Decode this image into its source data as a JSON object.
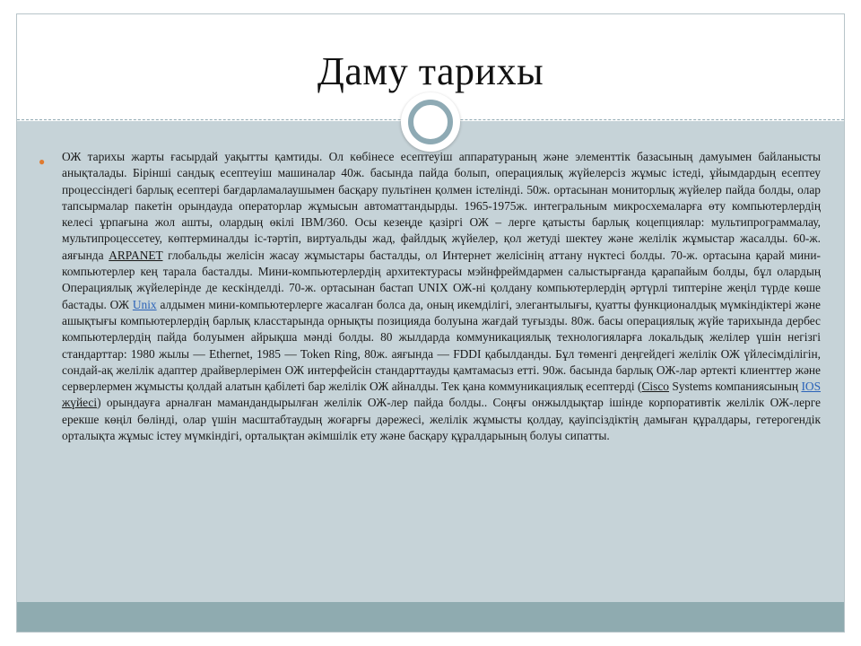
{
  "slide": {
    "title": "Даму тарихы",
    "paragraph": [
      "ОЖ тарихы жарты ғасырдай уақытты қамтиды. Ол көбінесе есептеуіш аппаратураның және элементтік базасының дамуымен байланысты анықталады. Бірінші сандық есептеуіш машиналар 40ж. басында пайда болып, операциялық жүйелерсіз жұмыс істеді, ұйымдардың есептеу процессіндегі барлық есептері бағдарламалаушымен басқару пультінен қолмен істелінді. 50ж. ортасынан мониторлық жүйелер пайда болды, олар тапсырмалар пакетін орындауда операторлар жұмысын автоматтандырды. 1965-1975ж. интегральным микросхемаларға өту компьютерлердің келесі ұрпағына жол ашты, олардың өкілі IBM/360. Осы кезеңде қазіргі ОЖ – лерге қатысты барлық коцепциялар: мультипрограммалау, мультипроцессетеу, көптерминалды іс-тәртіп, виртуальды жад, файлдық жүйелер, қол жетуді шектеу және желілік жұмыстар жасалды. 60-ж. аяғында ",
      " глобальды желісін жасау жұмыстары басталды, ол Интернет желісінің аттану нүктесі болды. 70-ж. ортасына қарай мини-компьютерлер кең тарала басталды. Мини-компьютерлердің архитектурасы мэйнфреймдармен салыстырғанда қарапайым болды, бұл олардың Операциялық жүйелерінде де кескінделді. 70-ж. ортасынан бастап UNIX ОЖ-ні қолдану компьютерлердің әртүрлі типтеріне жеңіл түрде көше бастады. ОЖ ",
      " алдымен мини-компьютерлерге жасалған болса да, оның икемділігі, элегантылығы, қуатты функционалдық мүмкіндіктері және ашықтығы компьютерлердің барлық класстарында орнықты позицияда болуына жағдай туғызды. 80ж. басы операциялық жүйе тарихында дербес компьютерлердің пайда болуымен айрықша мәнді болды. 80 жылдарда коммуникациялық технологияларға локальдық желілер үшін негізгі стандарттар: 1980 жылы — Ethernet, 1985 — Token Ring, 80ж. аяғында — FDDI қабылданды. Бұл төменгі деңгейдегі желілік ОЖ үйлесімділігін, сондай-ақ желілік адаптер драйверлерімен ОЖ интерфейсін стандарттауды қамтамасыз етті. 90ж. басында барлық ОЖ-лар әртекті клиенттер және серверлермен жұмысты қолдай алатын қабілеті бар желілік ОЖ айналды. Тек қана коммуникациялық есептерді (",
      " Systems компаниясының ",
      ") орындауға арналған мамандандырылған желілік ОЖ-лер пайда болды.. Соңғы онжылдықтар ішінде корпоративтік желілік ОЖ-лерге ерекше көңіл бөлінді, олар үшін масштабтаудың жоғарғы дәрежесі, желілік жұмысты қолдау, қауіпсіздіктің дамыған құралдары, гетерогендік орталықта жұмыс істеу мүмкіндігі, орталықтан әкімшілік ету және басқару құралдарының болуы сипатты."
    ],
    "links": {
      "arpanet": "ARPANET",
      "unix": "Unix",
      "cisco": "Cisco",
      "ios": "IOS",
      "ios_suffix": " жүйесі"
    },
    "colors": {
      "background": "#c6d3d8",
      "footer": "#8fabb0",
      "bullet": "#e07a2f",
      "link": "#2a62b8",
      "ring": "#8eaab4"
    },
    "icons": {
      "bullet": "bullet-dot-icon",
      "ring": "ring-ornament-icon"
    }
  }
}
